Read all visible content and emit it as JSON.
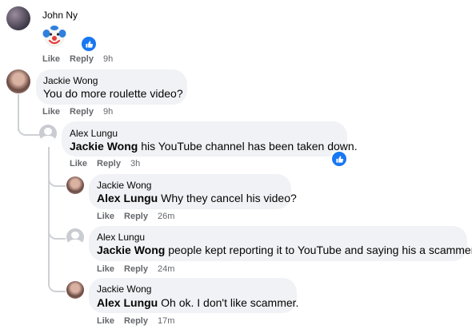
{
  "actions": {
    "like": "Like",
    "reply": "Reply"
  },
  "comments": [
    {
      "author": "John Ny",
      "text": "",
      "emoji": "clown-face",
      "time": "9h",
      "reaction": "like"
    },
    {
      "author": "Jackie Wong",
      "text": "You do more roulette video?",
      "time": "9h"
    },
    {
      "author": "Alex Lungu",
      "mention": "Jackie Wong",
      "text": " his YouTube channel has been taken down.",
      "time": "3h",
      "reaction": "like"
    },
    {
      "author": "Jackie Wong",
      "mention": "Alex Lungu",
      "text": " Why they cancel his video?",
      "time": "26m"
    },
    {
      "author": "Alex Lungu",
      "mention": "Jackie Wong",
      "text": " people kept reporting it to YouTube and saying his a scammer.",
      "time": "24m"
    },
    {
      "author": "Jackie Wong",
      "mention": "Alex Lungu",
      "text": " Oh ok. I don't like scammer.",
      "time": "17m"
    }
  ],
  "colors": {
    "bubble": "#f0f2f5",
    "meta": "#65676b",
    "like_blue": "#1877f2",
    "thread_line": "#ced0d4"
  }
}
